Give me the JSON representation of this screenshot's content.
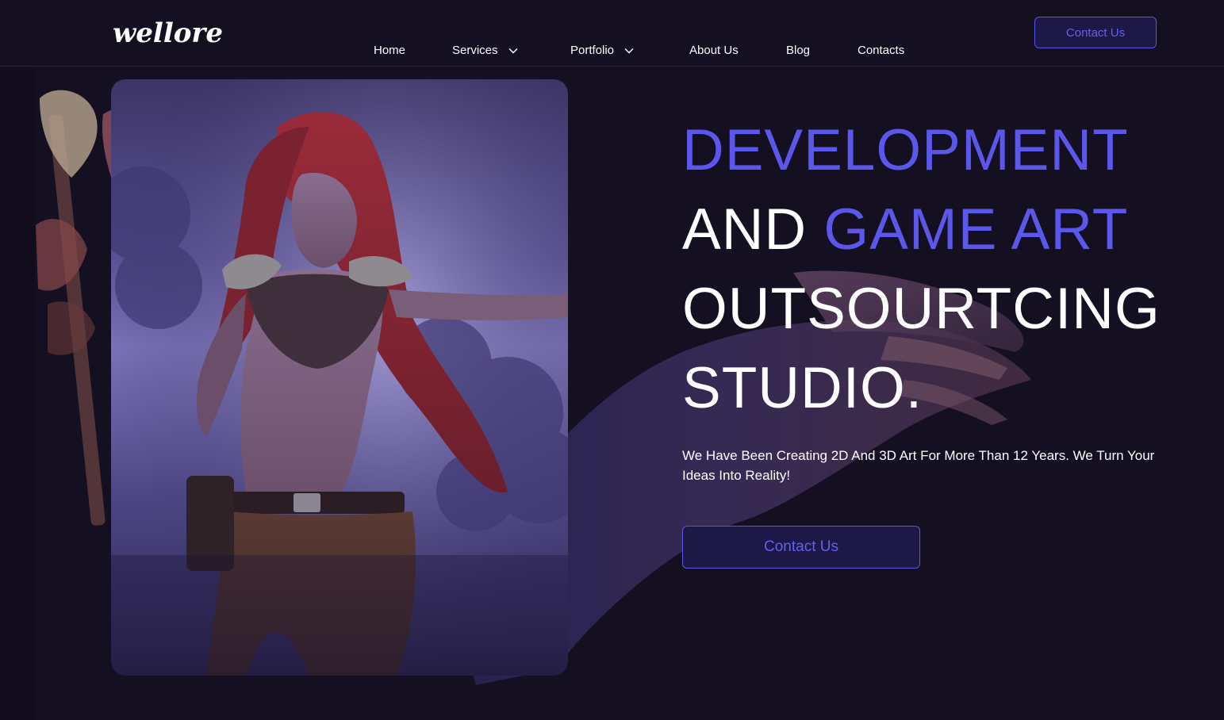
{
  "brand": {
    "logo_text": "wellore"
  },
  "nav": {
    "items": [
      {
        "label": "Home",
        "has_dropdown": false
      },
      {
        "label": "Services",
        "has_dropdown": true
      },
      {
        "label": "Portfolio",
        "has_dropdown": true
      },
      {
        "label": "About Us",
        "has_dropdown": false
      },
      {
        "label": "Blog",
        "has_dropdown": false
      },
      {
        "label": "Contacts",
        "has_dropdown": false
      }
    ],
    "cta_label": "Contact Us"
  },
  "hero": {
    "headline": {
      "line1": "DEVELOPMENT",
      "line2_part1": "AND ",
      "line2_part2": "GAME ART",
      "line3": "OUTSOURTCING",
      "line4": "STUDIO."
    },
    "subtitle": "We Have Been Creating 2D And 3D Art For More Than 12 Years. We Turn Your Ideas Into Reality!",
    "cta_label": "Contact Us"
  },
  "colors": {
    "background": "#150f22",
    "accent": "#5b57ea",
    "button_bg": "#1d1846",
    "text": "#ffffff"
  }
}
